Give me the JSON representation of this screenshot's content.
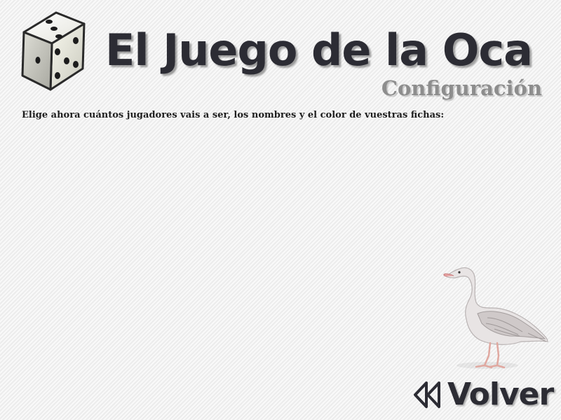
{
  "header": {
    "title": "El Juego de la Oca",
    "subtitle": "Configuración",
    "logo_icon": "dice-icon"
  },
  "main": {
    "instructions": "Elige ahora cuántos jugadores vais a ser, los nombres y el color de vuestras fichas:"
  },
  "decoration": {
    "goose_icon": "goose-illustration"
  },
  "footer": {
    "back_label": "Volver",
    "back_icon": "rewind-icon"
  },
  "colors": {
    "background": "#f1f1f1",
    "title": "#2c2c34",
    "subtitle": "#8d8d8d",
    "text": "#1e1e1e"
  }
}
